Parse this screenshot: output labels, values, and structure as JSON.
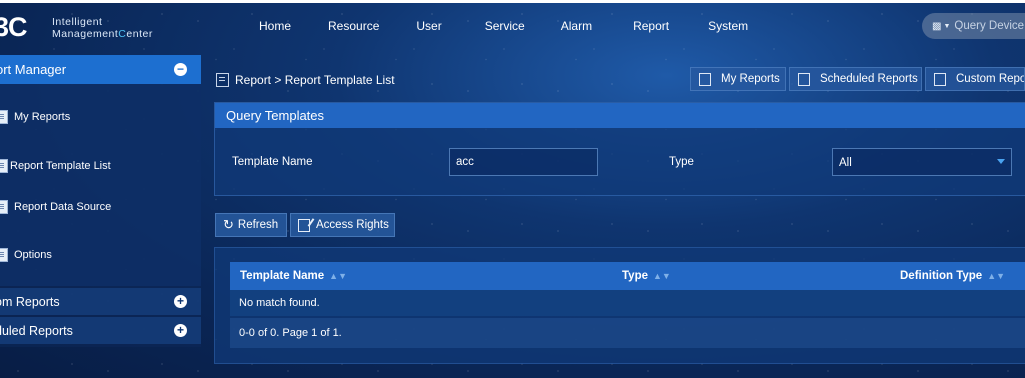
{
  "app": {
    "logo_mark": "3C",
    "logo_line1": "Intelligent",
    "logo_line2_prefix": "Management",
    "logo_line2_accent": "C",
    "logo_line2_suffix": "enter"
  },
  "nav": {
    "items": [
      "Home",
      "Resource",
      "User",
      "Service",
      "Alarm",
      "Report",
      "System"
    ]
  },
  "search": {
    "placeholder": "Query Device",
    "icon": "device-search-icon"
  },
  "sidebar": {
    "header": "ort Manager",
    "items": [
      {
        "label": "My Reports",
        "icon": "report-icon"
      },
      {
        "label": "Report Template List",
        "icon": "template-list-icon"
      },
      {
        "label": "Report Data Source",
        "icon": "data-source-icon"
      },
      {
        "label": "Options",
        "icon": "options-icon"
      }
    ],
    "groups": [
      "om Reports",
      "duled Reports"
    ]
  },
  "breadcrumb": "Report > Report Template List",
  "quick_tabs": [
    "My Reports",
    "Scheduled Reports",
    "Custom Repo"
  ],
  "query": {
    "title": "Query Templates",
    "template_name_label": "Template Name",
    "template_name_value": "acc",
    "type_label": "Type",
    "type_value": "All"
  },
  "toolbar": {
    "refresh": "Refresh",
    "access_rights": "Access Rights"
  },
  "table": {
    "columns": [
      "Template Name",
      "Type",
      "Definition Type"
    ],
    "empty_message": "No match found.",
    "pagination": "0-0 of 0. Page 1 of 1."
  },
  "colors": {
    "accent": "#1d6fd0",
    "header_blue": "#2266c2",
    "logo_accent": "#4fc3f7"
  }
}
